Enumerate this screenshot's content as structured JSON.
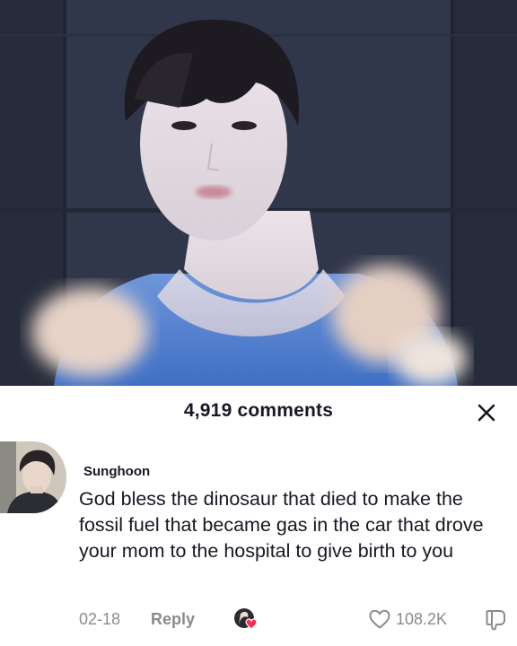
{
  "sheet": {
    "comment_count": "4,919 comments"
  },
  "comment": {
    "username": "Sunghoon",
    "text": "God bless the dinosaur that died to make the fossil fuel that became gas in the car that drove your mom to the hospital to give birth to you",
    "date": "02-18",
    "reply_label": "Reply",
    "likes": "108.2K"
  },
  "icons": {
    "close": "close-icon",
    "heart": "heart-icon",
    "dislike": "dislike-icon",
    "creator_liked": "creator-liked-badge"
  },
  "colors": {
    "text_primary": "#161823",
    "text_secondary": "#8a8b91",
    "creator_heart": "#fe2c55"
  }
}
